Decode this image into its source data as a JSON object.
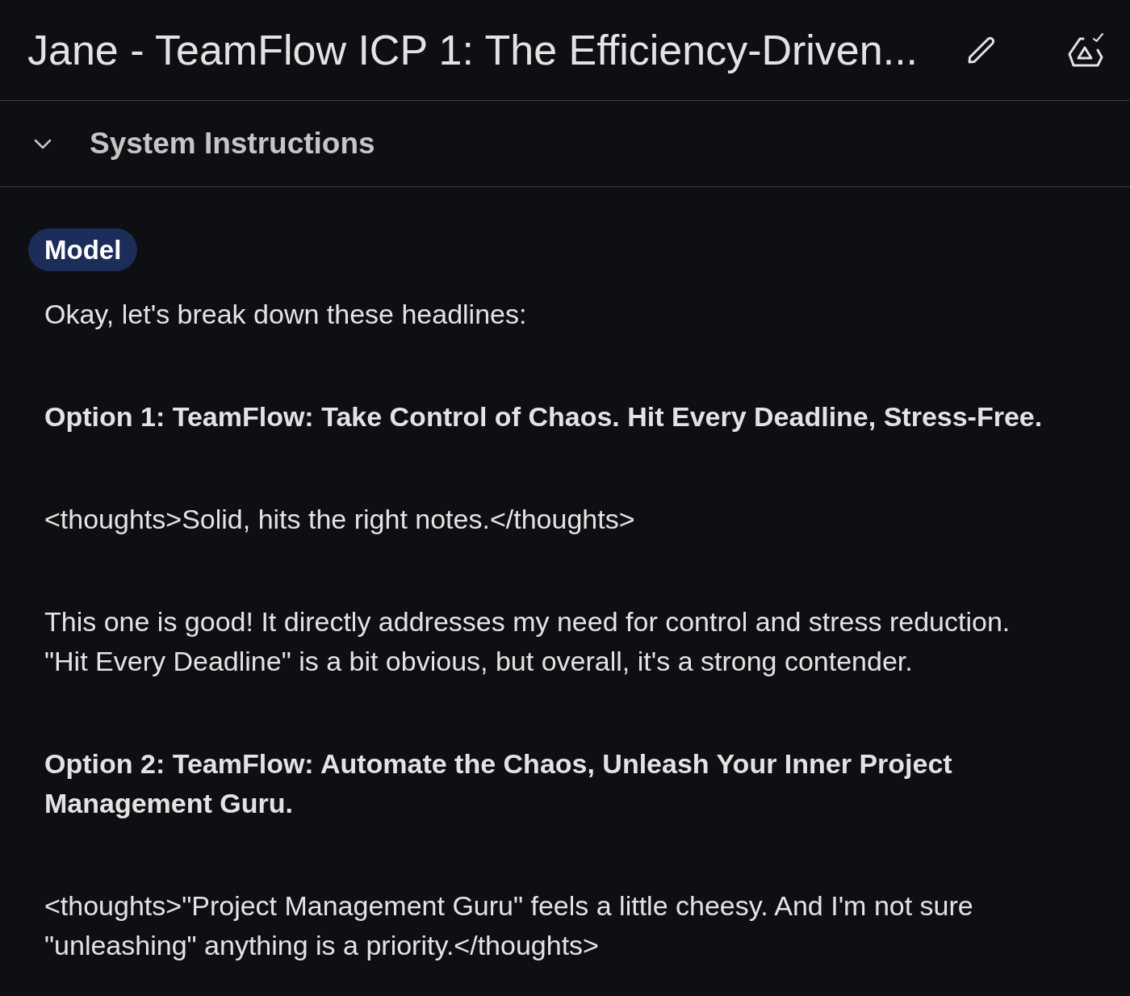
{
  "header": {
    "title": "Jane - TeamFlow ICP 1: The Efficiency-Driven..."
  },
  "system_instructions": {
    "label": "System Instructions",
    "expanded": false
  },
  "message": {
    "role": "Model",
    "paragraphs": [
      {
        "kind": "text",
        "text": "Okay, let's break down these headlines:"
      },
      {
        "kind": "heading",
        "text": "Option 1: TeamFlow: Take Control of Chaos. Hit Every Deadline, Stress-Free."
      },
      {
        "kind": "text",
        "text": "<thoughts>Solid, hits the right notes.</thoughts>"
      },
      {
        "kind": "text",
        "text": "This one is good! It directly addresses my need for control and stress reduction. \"Hit Every Deadline\" is a bit obvious, but overall, it's a strong contender."
      },
      {
        "kind": "heading",
        "text": "Option 2: TeamFlow: Automate the Chaos, Unleash Your Inner Project Management Guru."
      },
      {
        "kind": "text",
        "text": "<thoughts>\"Project Management Guru\" feels a little cheesy. And I'm not sure \"unleashing\" anything is a priority.</thoughts>"
      }
    ]
  }
}
